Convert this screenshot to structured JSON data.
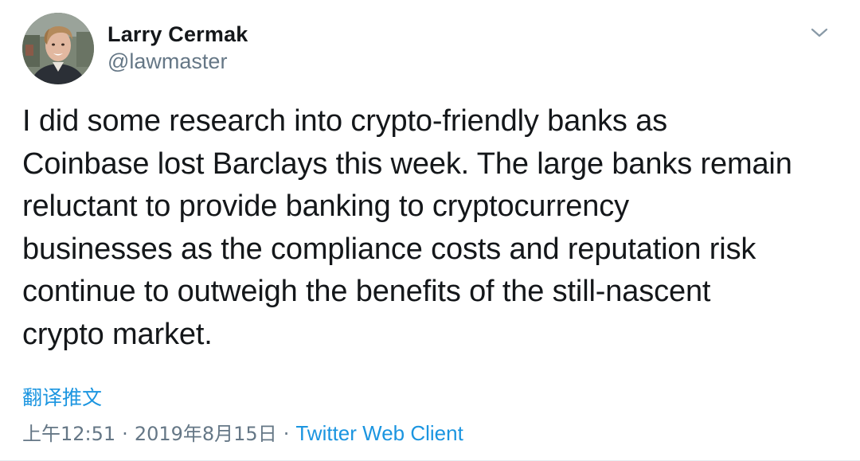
{
  "author": {
    "display_name": "Larry Cermak",
    "handle": "@lawmaster"
  },
  "tweet": {
    "text": "I did some research into crypto-friendly banks as\nCoinbase lost Barclays this week. The large banks remain\nreluctant to provide banking to cryptocurrency\nbusinesses as the compliance costs and reputation risk\ncontinue to outweigh the benefits of the still-nascent\ncrypto market.",
    "translate_label": "翻译推文",
    "time": "上午12:51",
    "date": "2019年8月15日",
    "separator": "·",
    "client": "Twitter Web Client"
  },
  "icons": {
    "menu": "chevron-down-icon"
  },
  "colors": {
    "text": "#14171a",
    "secondary": "#657786",
    "link": "#1b95e0"
  }
}
